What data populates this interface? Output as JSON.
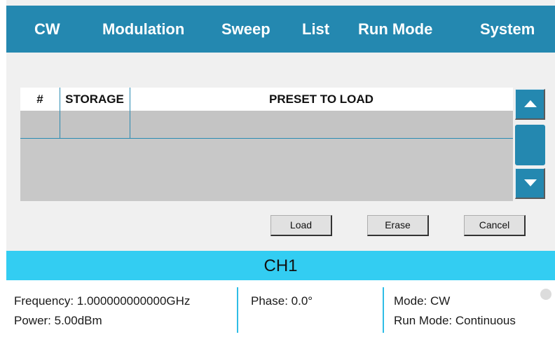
{
  "menu": {
    "items": [
      "CW",
      "Modulation",
      "Sweep",
      "List",
      "Run Mode",
      "System"
    ]
  },
  "table": {
    "headers": {
      "index": "#",
      "storage": "STORAGE",
      "preset": "PRESET TO LOAD"
    }
  },
  "scroll": {
    "up_icon": "triangle-up-icon",
    "down_icon": "triangle-down-icon"
  },
  "buttons": {
    "load": "Load",
    "erase": "Erase",
    "cancel": "Cancel"
  },
  "channel": {
    "label": "CH1"
  },
  "status": {
    "frequency": "Frequency: 1.000000000000GHz",
    "power": "Power: 5.00dBm",
    "phase": "Phase: 0.0°",
    "mode": "Mode: CW",
    "run_mode": "Run Mode: Continuous"
  },
  "colors": {
    "menu_bg": "#2488b0",
    "channel_bg": "#33cdf2",
    "table_bg": "#c8c8c8"
  }
}
